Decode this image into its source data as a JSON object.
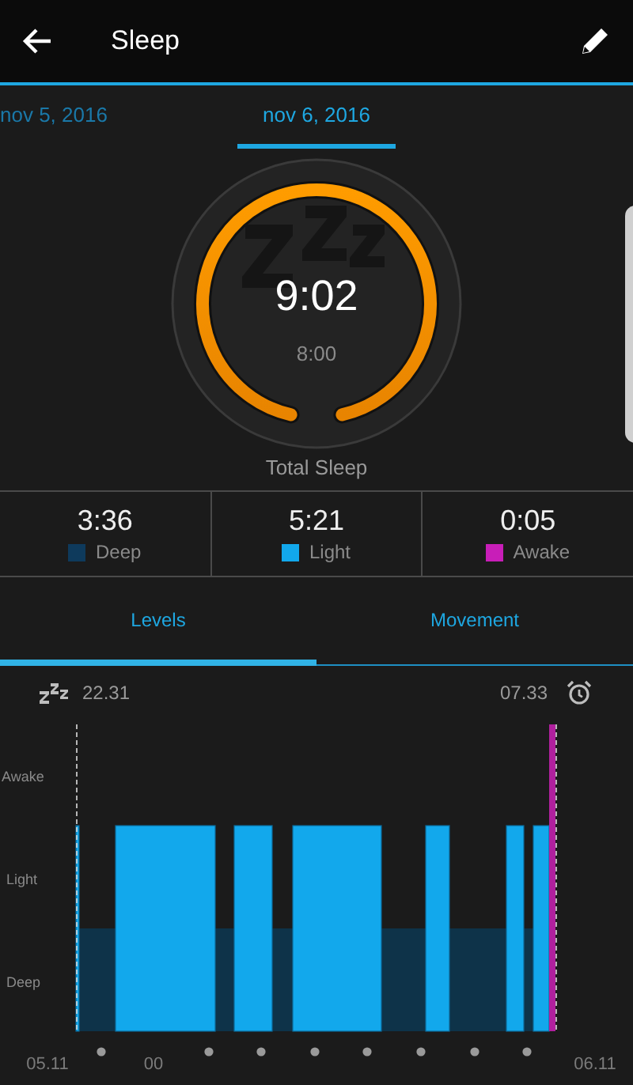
{
  "app_bar": {
    "title": "Sleep"
  },
  "date_tabs": [
    {
      "label": "nov 5, 2016",
      "selected": false
    },
    {
      "label": "nov 6, 2016",
      "selected": true
    }
  ],
  "summary": {
    "total": "9:02",
    "goal": "8:00",
    "label": "Total Sleep"
  },
  "stats": [
    {
      "value": "3:36",
      "label": "Deep",
      "color": "#0e3a5c"
    },
    {
      "value": "5:21",
      "label": "Light",
      "color": "#12a8ec"
    },
    {
      "value": "0:05",
      "label": "Awake",
      "color": "#c81eb8"
    }
  ],
  "view_tabs": [
    {
      "label": "Levels",
      "selected": true
    },
    {
      "label": "Movement",
      "selected": false
    }
  ],
  "chart": {
    "start": "22.31",
    "end": "07.33",
    "levels": [
      "Awake",
      "Light",
      "Deep"
    ],
    "axis_labels": [
      "05.11",
      "00",
      "06.11"
    ]
  }
}
